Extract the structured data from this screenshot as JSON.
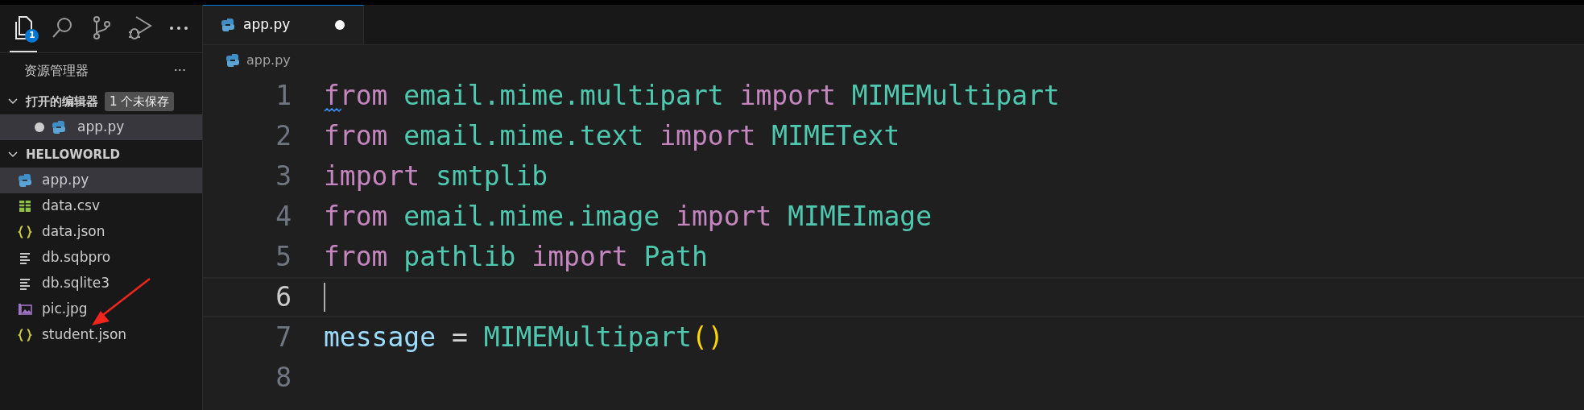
{
  "activity_bar": [
    {
      "kind": "explorer",
      "selected": true,
      "badge": "1"
    },
    {
      "kind": "search",
      "selected": false
    },
    {
      "kind": "source-control",
      "selected": false
    },
    {
      "kind": "run",
      "selected": false
    },
    {
      "kind": "more",
      "selected": false
    }
  ],
  "sidebar": {
    "title": "资源管理器",
    "actions": "···",
    "open_editors": {
      "title": "打开的编辑器",
      "expanded": true,
      "badge": "1 个未保存",
      "items": [
        {
          "name": "app.py",
          "kind": "python",
          "modified": true,
          "selected": true
        }
      ]
    },
    "folder": {
      "title": "HELLOWORLD",
      "expanded": true,
      "files": [
        {
          "name": "app.py",
          "kind": "python",
          "selected": true
        },
        {
          "name": "data.csv",
          "kind": "csv",
          "selected": false
        },
        {
          "name": "data.json",
          "kind": "json",
          "selected": false
        },
        {
          "name": "db.sqbpro",
          "kind": "text",
          "selected": false
        },
        {
          "name": "db.sqlite3",
          "kind": "text",
          "selected": false
        },
        {
          "name": "pic.jpg",
          "kind": "image",
          "selected": false
        },
        {
          "name": "student.json",
          "kind": "json",
          "selected": false
        }
      ]
    }
  },
  "annotation": {
    "kind": "arrow",
    "color": "#f0251b"
  },
  "editor": {
    "tabs": [
      {
        "label": "app.py",
        "kind": "python",
        "selected": true,
        "modified": true
      }
    ],
    "breadcrumb": {
      "label": "app.py",
      "kind": "python"
    },
    "lines": [
      {
        "number": "1",
        "current": false,
        "warning": true,
        "tokens": [
          {
            "text": "from ",
            "color": "#c586c0"
          },
          {
            "text": "email.mime.multipart ",
            "color": "#4ec9b0"
          },
          {
            "text": "import ",
            "color": "#c586c0"
          },
          {
            "text": "MIMEMultipart",
            "color": "#4ec9b0"
          }
        ]
      },
      {
        "number": "2",
        "current": false,
        "warning": false,
        "tokens": [
          {
            "text": "from ",
            "color": "#c586c0"
          },
          {
            "text": "email.mime.text ",
            "color": "#4ec9b0"
          },
          {
            "text": "import ",
            "color": "#c586c0"
          },
          {
            "text": "MIMEText",
            "color": "#4ec9b0"
          }
        ]
      },
      {
        "number": "3",
        "current": false,
        "warning": false,
        "tokens": [
          {
            "text": "import ",
            "color": "#c586c0"
          },
          {
            "text": "smtplib",
            "color": "#4ec9b0"
          }
        ]
      },
      {
        "number": "4",
        "current": false,
        "warning": false,
        "tokens": [
          {
            "text": "from ",
            "color": "#c586c0"
          },
          {
            "text": "email.mime.image ",
            "color": "#4ec9b0"
          },
          {
            "text": "import ",
            "color": "#c586c0"
          },
          {
            "text": "MIMEImage",
            "color": "#4ec9b0"
          }
        ]
      },
      {
        "number": "5",
        "current": false,
        "warning": false,
        "tokens": [
          {
            "text": "from ",
            "color": "#c586c0"
          },
          {
            "text": "pathlib ",
            "color": "#4ec9b0"
          },
          {
            "text": "import ",
            "color": "#c586c0"
          },
          {
            "text": "Path",
            "color": "#4ec9b0"
          }
        ]
      },
      {
        "number": "6",
        "current": true,
        "warning": false
      },
      {
        "number": "7",
        "current": false,
        "warning": false,
        "tokens": [
          {
            "text": "message ",
            "color": "#9cdcfe"
          },
          {
            "text": "= ",
            "color": "#d4d4d4"
          },
          {
            "text": "MIMEMultipart",
            "color": "#4ec9b0"
          },
          {
            "text": "()",
            "color": "#ffd700"
          }
        ]
      },
      {
        "number": "8",
        "current": false,
        "warning": false
      }
    ]
  }
}
